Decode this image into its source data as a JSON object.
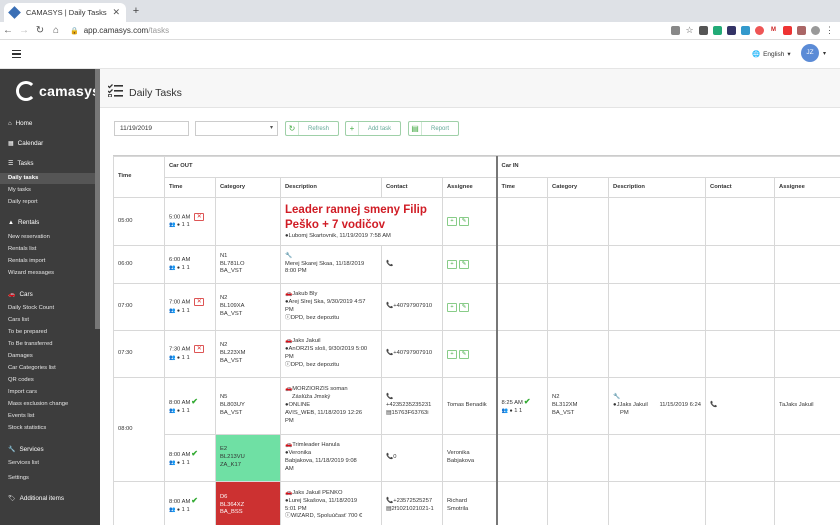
{
  "browser": {
    "tab_title": "CAMASYS | Daily Tasks",
    "url_domain": "app.camasys.com",
    "url_path": "/tasks"
  },
  "header": {
    "language": "English",
    "avatar_initials": "JZ"
  },
  "logo": "camasys",
  "sidebar": {
    "home": "Home",
    "calendar": "Calendar",
    "tasks": {
      "title": "Tasks",
      "items": [
        "Daily tasks",
        "My tasks",
        "Daily report"
      ]
    },
    "rentals": {
      "title": "Rentals",
      "items": [
        "New reservation",
        "Rentals list",
        "Rentals import",
        "Wizard messages"
      ]
    },
    "cars": {
      "title": "Cars",
      "items": [
        "Daily Stock Count",
        "Cars list",
        "To be prepared",
        "To Be transferred",
        "Damages",
        "Car Categories list",
        "QR codes",
        "Import cars",
        "Mass exclusion change",
        "Events list",
        "Stock statistics"
      ]
    },
    "services": {
      "title": "Services",
      "items": [
        "Services list",
        "Settings"
      ]
    },
    "additional": "Additional items"
  },
  "page": {
    "title": "Daily Tasks"
  },
  "toolbar": {
    "date": "11/19/2019",
    "select_value": "",
    "refresh": "Refresh",
    "add_task": "Add task",
    "report": "Report"
  },
  "grid": {
    "time_header": "Time",
    "car_out": "Car OUT",
    "car_in": "Car IN",
    "columns": {
      "time": "Time",
      "category": "Category",
      "description": "Description",
      "contact": "Contact",
      "assignee": "Assignee"
    },
    "rows": [
      {
        "slot": "05:00",
        "out_time": "5:00 AM",
        "counts": "1   1",
        "category": [],
        "leader": "Leader rannej smeny Filip Peško + 7 vodičov",
        "desc": [
          "Lubomj Skartovnik, 11/19/2019 7:58 AM"
        ],
        "contact": [],
        "assignee": []
      },
      {
        "slot": "06:00",
        "out_time": "6:00 AM",
        "counts": "1   1",
        "category": [
          "N1",
          "BL781LO",
          "BA_VST"
        ],
        "desc": [
          "Merej Skarej Skaa, 11/18/2019",
          "8:00 PM"
        ],
        "contact": [
          ""
        ],
        "assignee": []
      },
      {
        "slot": "07:00",
        "out_time": "7:00 AM",
        "counts": "1   1",
        "category": [
          "N2",
          "BL109XA",
          "BA_VST"
        ],
        "desc": [
          "Jakub Bly",
          "Arej Slrej Ska, 9/30/2019 4:57",
          "PM",
          "DPD, bez depozitu"
        ],
        "contact": [
          "+40797907910"
        ],
        "assignee": []
      },
      {
        "slot": "07:30",
        "out_time": "7:30 AM",
        "counts": "1   1",
        "category": [
          "N2",
          "BL223XM",
          "BA_VST"
        ],
        "desc": [
          "Jaks Jakuil",
          "AnORZIS sloš, 9/30/2019 5:00",
          "PM",
          "DPD, bez depozitu"
        ],
        "contact": [
          "+40797907910"
        ],
        "assignee": []
      },
      {
        "slot": "",
        "out_time": "8:00 AM",
        "counts": "1   1",
        "category": [
          "N5",
          "BL803UY",
          "BA_VST"
        ],
        "desc": [
          "MORZIORZIS soman",
          "Záslúža Jmský",
          "ONLINE",
          "AVIS_WEB, 11/18/2019 12:26",
          "PM"
        ],
        "contact": [
          "",
          "+4235235235231",
          "15763F63763i"
        ],
        "assignee": [
          "Tomas Benadik"
        ],
        "in_time": "8:25 AM",
        "in_counts": "1   1",
        "in_category": [
          "N2",
          "BL312XM",
          "BA_VST"
        ],
        "in_desc": [
          "JJaks Jakuil",
          "PM"
        ],
        "in_desc_date": "11/15/2019 6:24",
        "in_contact": [
          ""
        ],
        "in_assignee": [
          "TaJaks Jakuil"
        ]
      },
      {
        "slot": "08:00",
        "out_time": "8:00 AM",
        "counts": "1   1",
        "category": [
          "E2",
          "BL213VU",
          "ZA_K17"
        ],
        "desc": [
          "Trimleader Hanula",
          "Veronika",
          "Babjakova, 11/18/2019 9:08",
          "AM"
        ],
        "contact": [
          "0"
        ],
        "assignee": [
          "Veronika",
          "Babjakova"
        ]
      },
      {
        "slot": "",
        "out_time": "8:00 AM",
        "counts": "1   1",
        "category": [
          "D6",
          "BL364XZ",
          "BA_BSS"
        ],
        "desc": [
          "Jaks Jakuil       PENKO",
          "Lurej Skašova, 11/18/2019",
          "5:01 PM",
          "WIZARD, Spoluúčasť 700 €"
        ],
        "contact": [
          "+23572525257",
          "2f1021021021-1"
        ],
        "assignee": [
          "Richard",
          "Smotrila"
        ]
      }
    ]
  }
}
